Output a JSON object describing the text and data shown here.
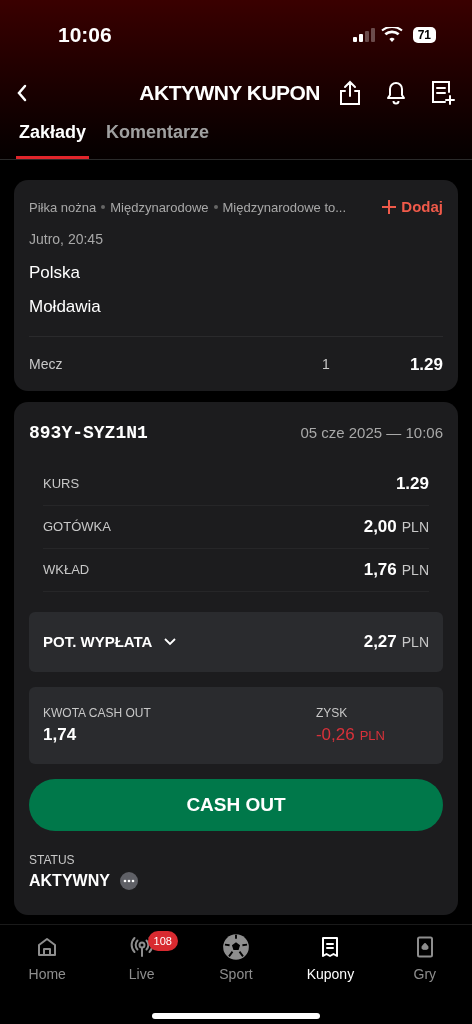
{
  "status_bar": {
    "time": "10:06",
    "battery": "71"
  },
  "header": {
    "title": "AKTYWNY KUPON"
  },
  "tabs": [
    {
      "label": "Zakłady",
      "selected": true
    },
    {
      "label": "Komentarze",
      "selected": false
    }
  ],
  "event": {
    "breadcrumb": [
      "Piłka nożna",
      "Międzynarodowe",
      "Międzynarodowe to..."
    ],
    "add_label": "Dodaj",
    "time": "Jutro, 20:45",
    "teams": [
      "Polska",
      "Mołdawia"
    ],
    "market": "Mecz",
    "pick": "1",
    "odds": "1.29"
  },
  "coupon": {
    "id": "893Y-SYZ1N1",
    "date": "05 cze 2025 — 10:06",
    "rows": [
      {
        "label": "KURS",
        "value": "1.29"
      },
      {
        "label": "GOTÓWKA",
        "value": "2,00",
        "unit": "PLN"
      },
      {
        "label": "WKŁAD",
        "value": "1,76",
        "unit": "PLN"
      }
    ],
    "payout": {
      "label": "POT. WYPŁATA",
      "value": "2,27",
      "unit": "PLN"
    },
    "cashout": {
      "label": "KWOTA CASH OUT",
      "value": "1,74"
    },
    "profit": {
      "label": "ZYSK",
      "value": "-0,26",
      "unit": "PLN"
    },
    "button": "CASH OUT",
    "status_label": "STATUS",
    "status": "AKTYWNY"
  },
  "nav": [
    {
      "label": "Home",
      "kind": "home",
      "selected": false
    },
    {
      "label": "Live",
      "kind": "live",
      "selected": false,
      "badge": "108"
    },
    {
      "label": "Sport",
      "kind": "sport",
      "selected": false
    },
    {
      "label": "Kupony",
      "kind": "coupons",
      "selected": true
    },
    {
      "label": "Gry",
      "kind": "games",
      "selected": false
    }
  ]
}
